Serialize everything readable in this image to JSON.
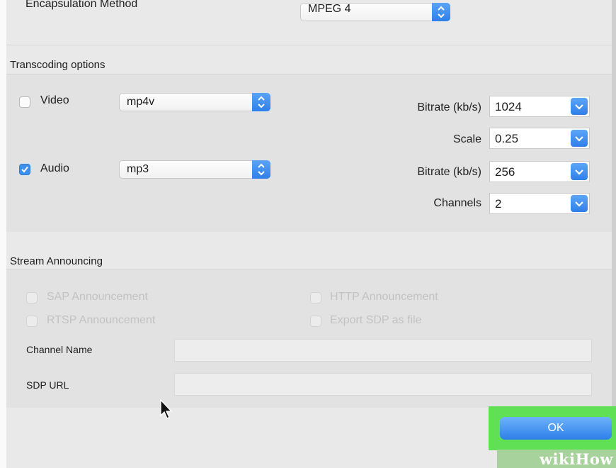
{
  "encapsulation": {
    "label": "Encapsulation Method",
    "value": "MPEG 4"
  },
  "transcoding": {
    "title": "Transcoding options",
    "video": {
      "label": "Video",
      "checked": false,
      "codec": "mp4v",
      "bitrate_label": "Bitrate (kb/s)",
      "bitrate": "1024",
      "scale_label": "Scale",
      "scale": "0.25"
    },
    "audio": {
      "label": "Audio",
      "checked": true,
      "codec": "mp3",
      "bitrate_label": "Bitrate (kb/s)",
      "bitrate": "256",
      "channels_label": "Channels",
      "channels": "2"
    }
  },
  "stream": {
    "title": "Stream Announcing",
    "sap": "SAP Announcement",
    "rtsp": "RTSP Announcement",
    "http": "HTTP Announcement",
    "export_sdp": "Export SDP as file",
    "channel_name_label": "Channel Name",
    "channel_name_value": "",
    "sdp_url_label": "SDP URL",
    "sdp_url_value": ""
  },
  "ok_label": "OK",
  "watermark": "wikiHow",
  "colors": {
    "accent": "#3d8ff0",
    "highlight": "#5fe055"
  }
}
